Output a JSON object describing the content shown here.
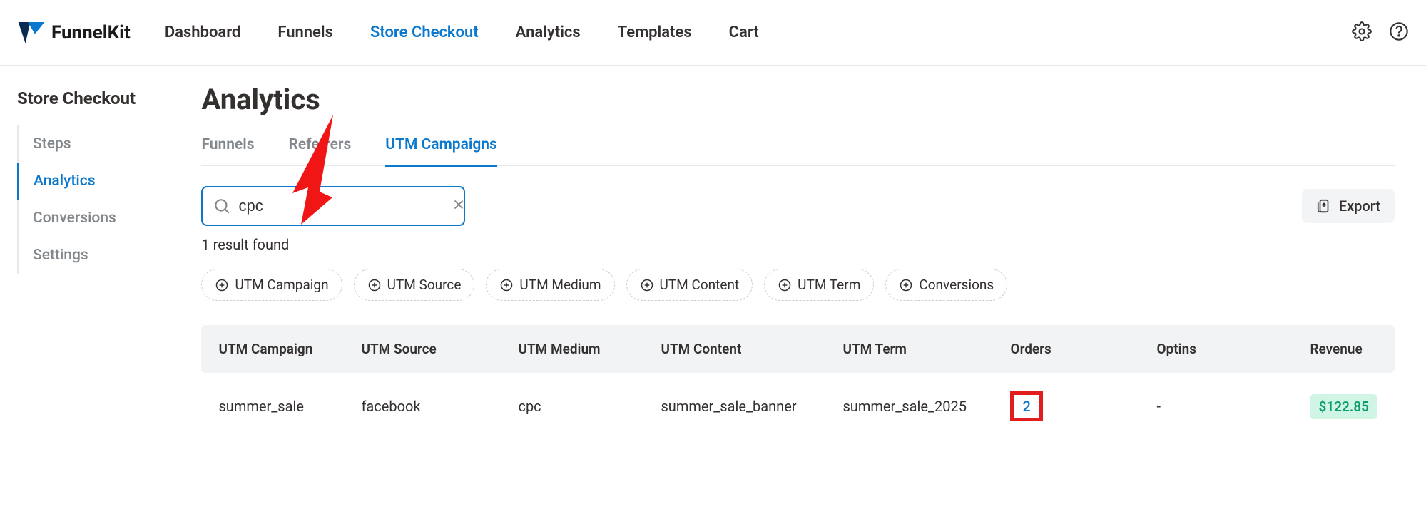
{
  "brand": "FunnelKit",
  "topnav": [
    {
      "label": "Dashboard",
      "active": false
    },
    {
      "label": "Funnels",
      "active": false
    },
    {
      "label": "Store Checkout",
      "active": true
    },
    {
      "label": "Analytics",
      "active": false
    },
    {
      "label": "Templates",
      "active": false
    },
    {
      "label": "Cart",
      "active": false
    }
  ],
  "sidebar": {
    "title": "Store Checkout",
    "items": [
      {
        "label": "Steps",
        "active": false
      },
      {
        "label": "Analytics",
        "active": true
      },
      {
        "label": "Conversions",
        "active": false
      },
      {
        "label": "Settings",
        "active": false
      }
    ]
  },
  "page_title": "Analytics",
  "tabs": [
    {
      "label": "Funnels",
      "active": false
    },
    {
      "label": "Referrers",
      "active": false
    },
    {
      "label": "UTM Campaigns",
      "active": true
    }
  ],
  "search": {
    "value": "cpc"
  },
  "export_label": "Export",
  "results_count": "1 result found",
  "chips": [
    "UTM Campaign",
    "UTM Source",
    "UTM Medium",
    "UTM Content",
    "UTM Term",
    "Conversions"
  ],
  "columns": [
    "UTM Campaign",
    "UTM Source",
    "UTM Medium",
    "UTM Content",
    "UTM Term",
    "Orders",
    "Optins",
    "Revenue"
  ],
  "rows": [
    {
      "campaign": "summer_sale",
      "source": "facebook",
      "medium": "cpc",
      "content": "summer_sale_banner",
      "term": "summer_sale_2025",
      "orders": "2",
      "optins": "-",
      "revenue": "$122.85"
    }
  ]
}
